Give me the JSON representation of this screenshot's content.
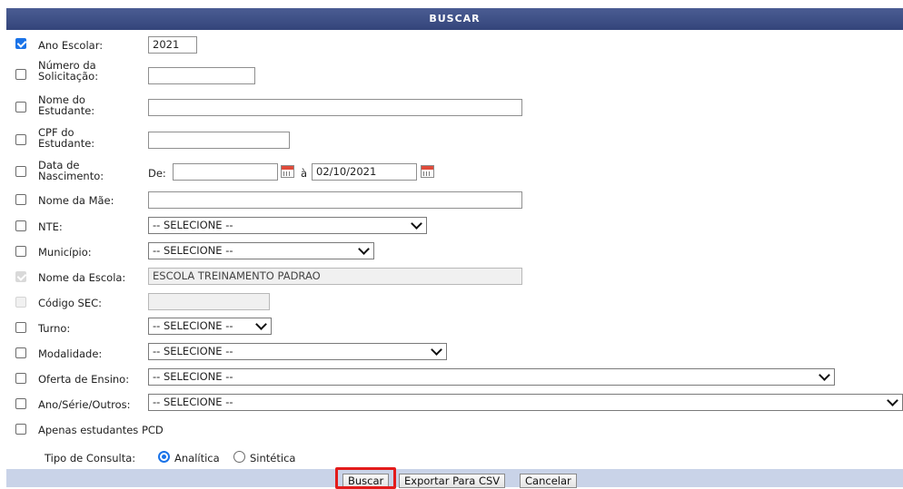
{
  "header": {
    "title": "BUSCAR"
  },
  "fields": {
    "ano_escolar": {
      "label": "Ano Escolar:",
      "value": "2021",
      "checked": true
    },
    "numero_solicitacao": {
      "label_line1": "Número da",
      "label_line2": "Solicitação:",
      "value": ""
    },
    "nome_estudante": {
      "label_line1": "Nome do",
      "label_line2": "Estudante:",
      "value": ""
    },
    "cpf_estudante": {
      "label_line1": "CPF do",
      "label_line2": "Estudante:",
      "value": ""
    },
    "data_nascimento": {
      "label_line1": "Data de",
      "label_line2": "Nascimento:",
      "de_label": "De:",
      "de_value": "",
      "a_label": "à",
      "a_value": "02/10/2021"
    },
    "nome_mae": {
      "label": "Nome da Mãe:",
      "value": ""
    },
    "nte": {
      "label": "NTE:",
      "selected": "-- SELECIONE --"
    },
    "municipio": {
      "label": "Município:",
      "selected": "-- SELECIONE --"
    },
    "nome_escola": {
      "label": "Nome da Escola:",
      "value": "ESCOLA TREINAMENTO PADRAO"
    },
    "codigo_sec": {
      "label": "Código SEC:",
      "value": ""
    },
    "turno": {
      "label": "Turno:",
      "selected": "-- SELECIONE --"
    },
    "modalidade": {
      "label": "Modalidade:",
      "selected": "-- SELECIONE --"
    },
    "oferta_ensino": {
      "label": "Oferta de Ensino:",
      "selected": "-- SELECIONE --"
    },
    "ano_serie": {
      "label": "Ano/Série/Outros:",
      "selected": "-- SELECIONE --"
    },
    "pcd": {
      "label": "Apenas estudantes PCD"
    }
  },
  "tipo_consulta": {
    "label": "Tipo de Consulta:",
    "option1": "Analítica",
    "option2": "Sintética",
    "selected": "Analítica"
  },
  "buttons": {
    "buscar": "Buscar",
    "exportar": "Exportar Para CSV",
    "cancelar": "Cancelar"
  },
  "colors": {
    "header": "#3d4f86",
    "footer": "#c9d3e8",
    "accent": "#1a73e8",
    "highlight": "#e31b1b"
  }
}
